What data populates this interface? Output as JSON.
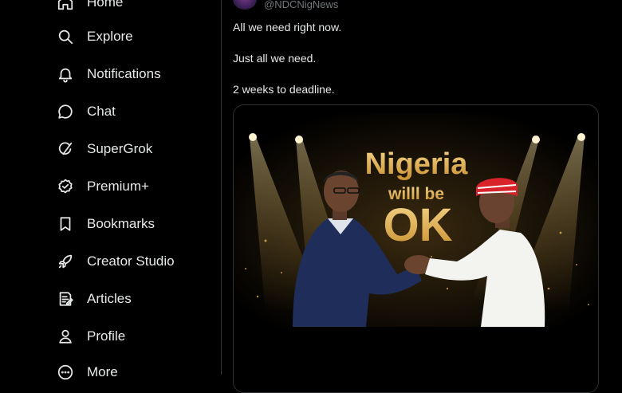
{
  "sidebar": {
    "items": [
      {
        "label": "Home",
        "icon": "home-icon"
      },
      {
        "label": "Explore",
        "icon": "search-icon"
      },
      {
        "label": "Notifications",
        "icon": "bell-icon"
      },
      {
        "label": "Chat",
        "icon": "chat-bubble-icon"
      },
      {
        "label": "SuperGrok",
        "icon": "grok-icon"
      },
      {
        "label": "Premium+",
        "icon": "verified-badge-icon"
      },
      {
        "label": "Bookmarks",
        "icon": "bookmark-icon"
      },
      {
        "label": "Creator Studio",
        "icon": "rocket-icon"
      },
      {
        "label": "Articles",
        "icon": "article-icon"
      },
      {
        "label": "Profile",
        "icon": "person-icon"
      },
      {
        "label": "More",
        "icon": "more-circle-icon"
      }
    ]
  },
  "post": {
    "handle": "@NDCNigNews",
    "lines": [
      "All we need right now.",
      "Just all we need.",
      "2 weeks to deadline."
    ],
    "image_text": {
      "line1": "Nigeria",
      "line2": "willl be",
      "line3": "OK"
    }
  },
  "colors": {
    "background": "#000000",
    "text": "#e7e9ea",
    "muted": "#71767b",
    "border": "#2f3336",
    "gold": "#e9b44c"
  }
}
